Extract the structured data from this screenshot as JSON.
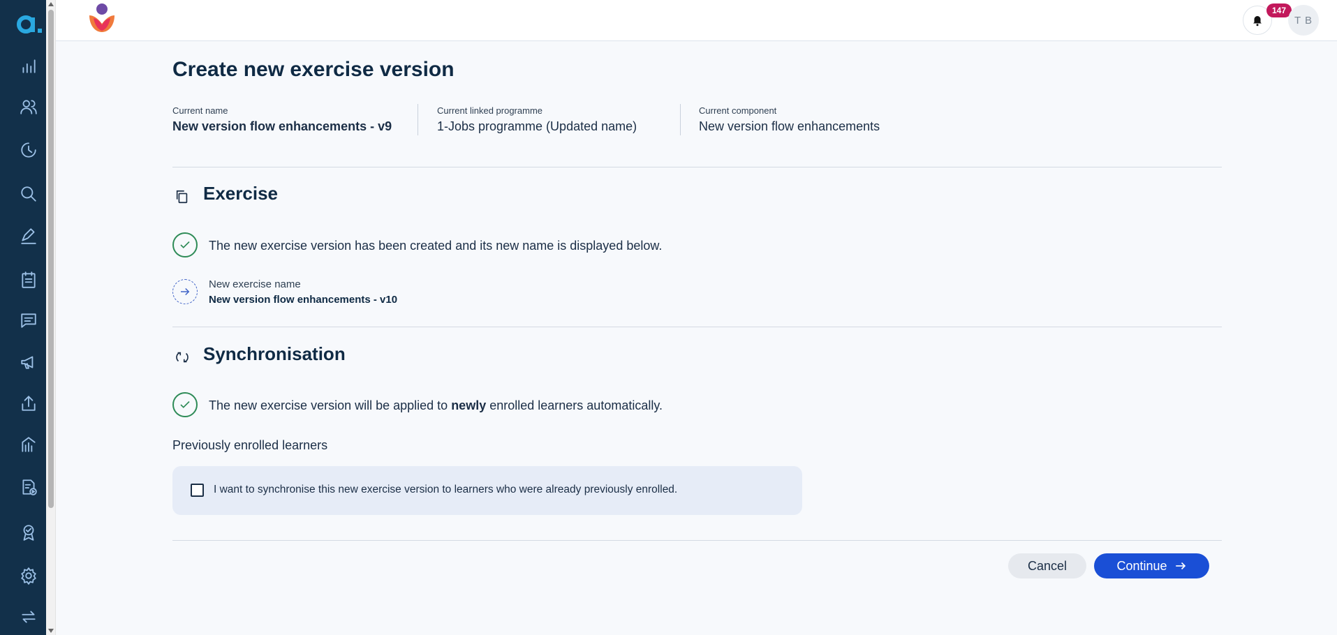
{
  "app": {
    "badge_count": "147",
    "avatar_initials": "T B",
    "accent_color": "#1a4fd6",
    "sidebar_color": "#12304a"
  },
  "sidebar": {
    "items": [
      {
        "name": "analytics-icon"
      },
      {
        "name": "users-icon"
      },
      {
        "name": "clock-icon"
      },
      {
        "name": "search-icon"
      },
      {
        "name": "pen-icon"
      },
      {
        "name": "clipboard-icon"
      },
      {
        "name": "chat-icon"
      },
      {
        "name": "megaphone-icon"
      },
      {
        "name": "upload-icon"
      },
      {
        "name": "report-icon"
      },
      {
        "name": "document-play-icon"
      },
      {
        "name": "award-icon"
      },
      {
        "name": "gear-icon"
      },
      {
        "name": "switch-icon"
      }
    ]
  },
  "page": {
    "title": "Create new exercise version",
    "current_name_label": "Current name",
    "current_name_value": "New version flow enhancements - v9",
    "current_programme_label": "Current linked programme",
    "current_programme_value": "1-Jobs programme (Updated name)",
    "current_component_label": "Current component",
    "current_component_value": "New version flow enhancements"
  },
  "exercise": {
    "title": "Exercise",
    "created_text": "The new exercise version has been created and its new name is displayed below.",
    "new_name_label": "New exercise name",
    "new_name_value": "New version flow enhancements - v10"
  },
  "sync": {
    "title": "Synchronisation",
    "auto_text_before": "The new exercise version will be applied to ",
    "auto_text_bold": "newly",
    "auto_text_after": " enrolled learners automatically.",
    "previously_label": "Previously enrolled learners",
    "checkbox_label": "I want to synchronise this new exercise version to learners who were already previously enrolled.",
    "checkbox_checked": false
  },
  "actions": {
    "cancel_label": "Cancel",
    "continue_label": "Continue"
  }
}
